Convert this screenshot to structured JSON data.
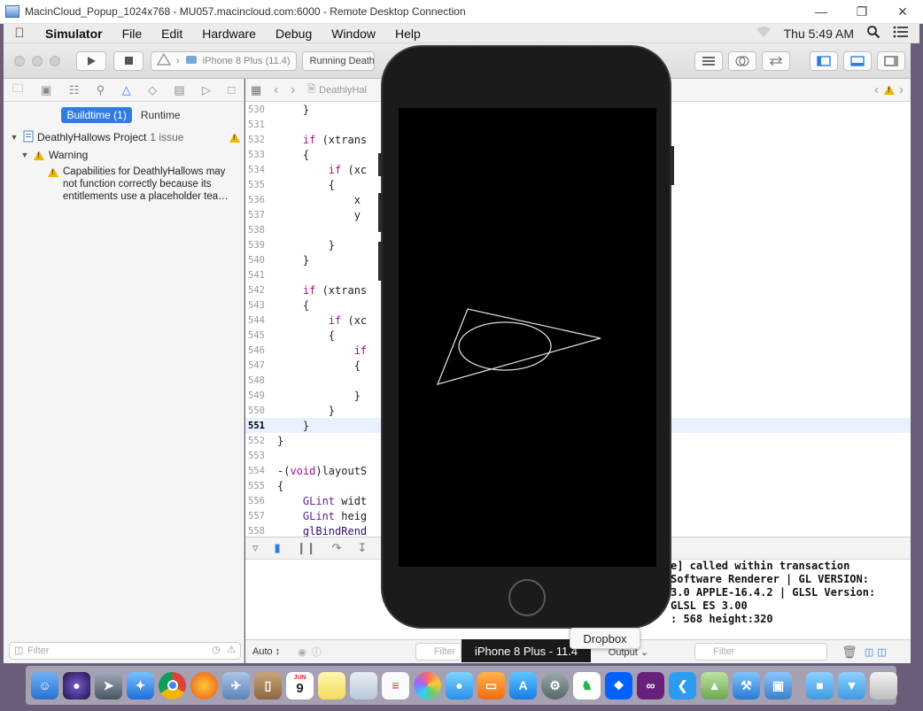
{
  "window": {
    "title": "MacinCloud_Popup_1024x768 - MU057.macincloud.com:6000 - Remote Desktop Connection",
    "minimize": "—",
    "restore": "❐",
    "close": "✕"
  },
  "menubar": {
    "app": "Simulator",
    "items": [
      "File",
      "Edit",
      "Hardware",
      "Debug",
      "Window",
      "Help"
    ],
    "clock": "Thu 5:49 AM"
  },
  "toolbar": {
    "scheme_device": "iPhone 8 Plus (11.4)",
    "status": "Running DeathlyHallows"
  },
  "navigator": {
    "seg_buildtime": "Buildtime (1)",
    "seg_runtime": "Runtime",
    "project": "DeathlyHallows Project",
    "project_count": "1 issue",
    "group": "Warning",
    "issue": "Capabilities for DeathlyHallows may not function correctly because its entitlements use a placeholder tea…",
    "filter_placeholder": "Filter"
  },
  "jumpbar": {
    "file": "DeathlyHal"
  },
  "code_lines": [
    {
      "n": "530",
      "code": "    }"
    },
    {
      "n": "531",
      "code": ""
    },
    {
      "n": "532",
      "code": "    if (xtrans"
    },
    {
      "n": "533",
      "code": "    {"
    },
    {
      "n": "534",
      "code": "        if (xc"
    },
    {
      "n": "535",
      "code": "        {"
    },
    {
      "n": "536",
      "code": "            x"
    },
    {
      "n": "537",
      "code": "            y"
    },
    {
      "n": "538",
      "code": ""
    },
    {
      "n": "539",
      "code": "        }"
    },
    {
      "n": "540",
      "code": "    }"
    },
    {
      "n": "541",
      "code": ""
    },
    {
      "n": "542",
      "code": "    if (xtrans"
    },
    {
      "n": "543",
      "code": "    {"
    },
    {
      "n": "544",
      "code": "        if (xc"
    },
    {
      "n": "545",
      "code": "        {"
    },
    {
      "n": "546",
      "code": "            if"
    },
    {
      "n": "547",
      "code": "            {"
    },
    {
      "n": "548",
      "code": ""
    },
    {
      "n": "549",
      "code": "            }"
    },
    {
      "n": "550",
      "code": "        }"
    },
    {
      "n": "551",
      "code": "    }"
    },
    {
      "n": "552",
      "code": "}"
    },
    {
      "n": "553",
      "code": ""
    },
    {
      "n": "554",
      "code": "-(void)layoutS"
    },
    {
      "n": "555",
      "code": "{"
    },
    {
      "n": "556",
      "code": "    GLint widt"
    },
    {
      "n": "557",
      "code": "    GLint heig"
    },
    {
      "n": "558",
      "code": "    glBindRend                                         ;"
    }
  ],
  "console_lines": [
    "e] called within transaction",
    "Software Renderer | GL VERSION:",
    "3.0 APPLE-16.4.2 | GLSL Version:",
    "GLSL ES 3.00",
    ": 568 height:320"
  ],
  "bottom": {
    "auto": "Auto ↕",
    "filter_mid": "Filter",
    "output": "Output ⌄",
    "filter_right": "Filter"
  },
  "simulator": {
    "device_label": "iPhone 8 Plus - 11.4"
  },
  "tooltip": "Dropbox",
  "dock": {
    "calendar_month": "JUN",
    "calendar_day": "9"
  }
}
